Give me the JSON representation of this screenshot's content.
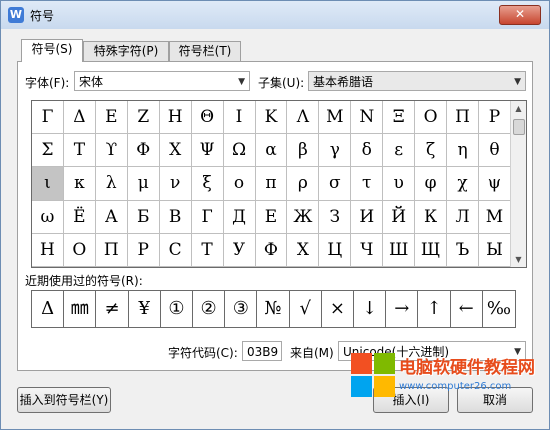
{
  "window": {
    "title": "符号",
    "app_icon": "W",
    "close": "✕"
  },
  "tabs": [
    {
      "label": "符号(S)",
      "active": true
    },
    {
      "label": "特殊字符(P)",
      "active": false
    },
    {
      "label": "符号栏(T)",
      "active": false
    }
  ],
  "font": {
    "label": "字体(F):",
    "value": "宋体"
  },
  "subset": {
    "label": "子集(U):",
    "value": "基本希腊语"
  },
  "symbols": [
    [
      "Γ",
      "Δ",
      "Ε",
      "Ζ",
      "Η",
      "Θ",
      "Ι",
      "Κ",
      "Λ",
      "Μ",
      "Ν",
      "Ξ",
      "Ο",
      "Π",
      "Ρ"
    ],
    [
      "Σ",
      "Τ",
      "ϒ",
      "Φ",
      "Χ",
      "Ψ",
      "Ω",
      "α",
      "β",
      "γ",
      "δ",
      "ε",
      "ζ",
      "η",
      "θ"
    ],
    [
      "ι",
      "κ",
      "λ",
      "μ",
      "ν",
      "ξ",
      "ο",
      "π",
      "ρ",
      "σ",
      "τ",
      "υ",
      "φ",
      "χ",
      "ψ"
    ],
    [
      "ω",
      "Ё",
      "А",
      "Б",
      "В",
      "Г",
      "Д",
      "Е",
      "Ж",
      "З",
      "И",
      "Й",
      "К",
      "Л",
      "М"
    ],
    [
      "Н",
      "О",
      "П",
      "Р",
      "С",
      "Т",
      "У",
      "Ф",
      "Х",
      "Ц",
      "Ч",
      "Ш",
      "Щ",
      "Ъ",
      "Ы"
    ]
  ],
  "selected": {
    "row": 2,
    "col": 0
  },
  "recent": {
    "label": "近期使用过的符号(R):",
    "items": [
      "Δ",
      "㎜",
      "≠",
      "¥",
      "①",
      "②",
      "③",
      "№",
      "√",
      "×",
      "↓",
      "→",
      "↑",
      "←",
      "‰"
    ]
  },
  "char_code": {
    "label": "字符代码(C):",
    "value": "03B9"
  },
  "from": {
    "label": "来自(M)",
    "value": "Unicode(十六进制)"
  },
  "buttons": {
    "insert_to_bar": "插入到符号栏(Y)",
    "insert": "插入(I)",
    "cancel": "取消"
  },
  "watermark": {
    "text": "电脑软硬件教程网",
    "url": "www.computer26.com"
  },
  "colors": {
    "selection": "#c4c4c4",
    "watermark_text": "#e74c1c",
    "watermark_url": "#2e7ad3"
  }
}
